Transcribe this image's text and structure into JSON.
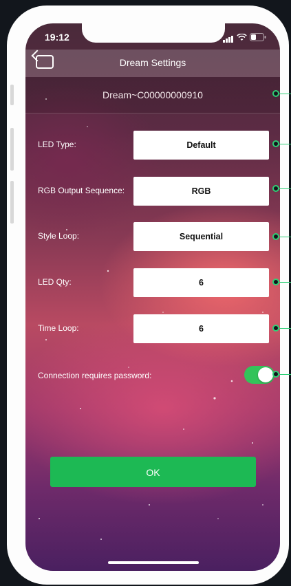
{
  "status_bar": {
    "time": "19:12"
  },
  "nav": {
    "title": "Dream Settings"
  },
  "device_name": "Dream~C00000000910",
  "settings": [
    {
      "label": "LED Type:",
      "value": "Default"
    },
    {
      "label": "RGB Output Sequence:",
      "value": "RGB"
    },
    {
      "label": "Style Loop:",
      "value": "Sequential"
    },
    {
      "label": "LED Qty:",
      "value": "6"
    },
    {
      "label": "Time Loop:",
      "value": "6"
    }
  ],
  "password_toggle": {
    "label": "Connection requires password:",
    "state": "on"
  },
  "ok_button": {
    "label": "OK"
  },
  "colors": {
    "accent_green": "#1db954",
    "toggle_green": "#33c35a",
    "callout_green": "#2ecf75"
  }
}
